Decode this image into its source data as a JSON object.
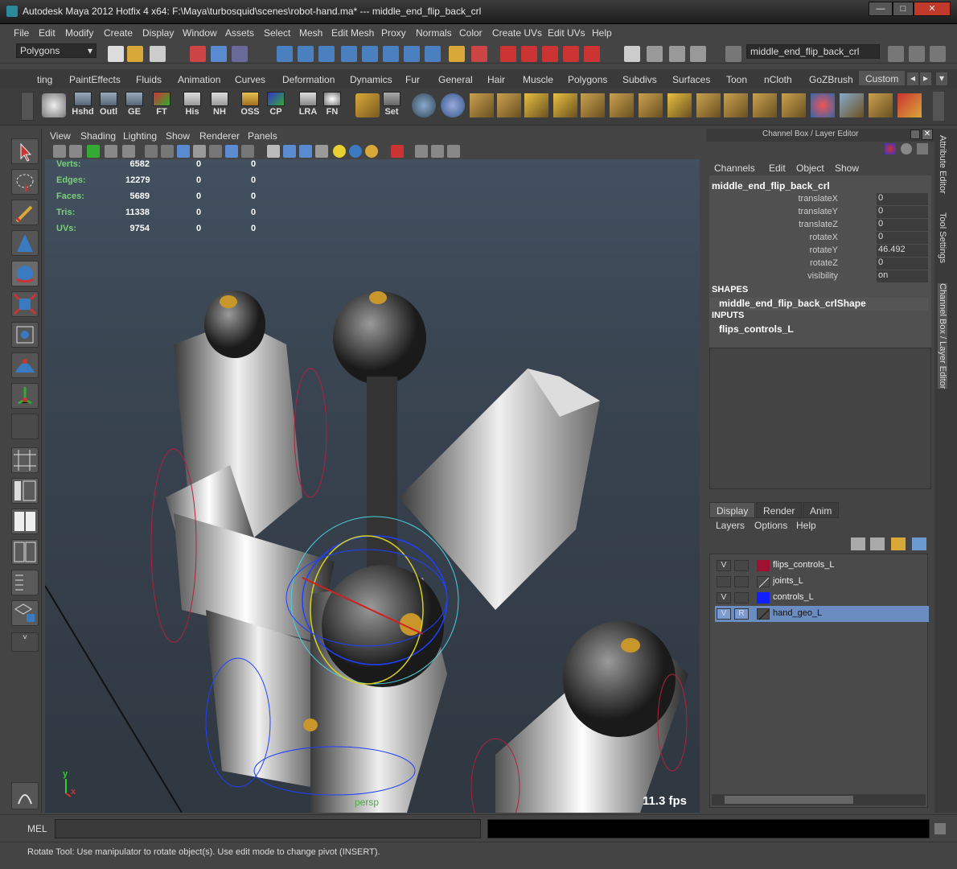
{
  "window": {
    "title": "Autodesk Maya 2012 Hotfix 4 x64: F:\\Maya\\turbosquid\\scenes\\robot-hand.ma*   ---   middle_end_flip_back_crl",
    "min": "—",
    "max": "□",
    "close": "✕"
  },
  "menubar": [
    "File",
    "Edit",
    "Modify",
    "Create",
    "Display",
    "Window",
    "Assets",
    "Select",
    "Mesh",
    "Edit Mesh",
    "Proxy",
    "Normals",
    "Color",
    "Create UVs",
    "Edit UVs",
    "Help"
  ],
  "statusline": {
    "mode": "Polygons",
    "selection_field": "middle_end_flip_back_crl"
  },
  "shelf_tabs": [
    "ting",
    "PaintEffects",
    "Fluids",
    "Animation",
    "Curves",
    "Deformation",
    "Dynamics",
    "Fur",
    "General",
    "Hair",
    "Muscle",
    "Polygons",
    "Subdivs",
    "Surfaces",
    "Toon",
    "nCloth",
    "GoZBrush",
    "Custom"
  ],
  "shelf_active_tab": "Custom",
  "shelf_buttons": [
    "Hshd",
    "Outl",
    "GE",
    "FT",
    "His",
    "NH",
    "OSS",
    "CP",
    "LRA",
    "FN",
    "Set"
  ],
  "viewport": {
    "menu": [
      "View",
      "Shading",
      "Lighting",
      "Show",
      "Renderer",
      "Panels"
    ],
    "stats": [
      {
        "label": "Verts:",
        "a": "6582",
        "b": "0",
        "c": "0"
      },
      {
        "label": "Edges:",
        "a": "12279",
        "b": "0",
        "c": "0"
      },
      {
        "label": "Faces:",
        "a": "5689",
        "b": "0",
        "c": "0"
      },
      {
        "label": "Tris:",
        "a": "11338",
        "b": "0",
        "c": "0"
      },
      {
        "label": "UVs:",
        "a": "9754",
        "b": "0",
        "c": "0"
      }
    ],
    "fps": "11.3 fps",
    "camera": "persp",
    "axis_y": "y",
    "axis_x": "x"
  },
  "channel_box": {
    "header": "Channel Box / Layer Editor",
    "menu": [
      "Channels",
      "Edit",
      "Object",
      "Show"
    ],
    "node": "middle_end_flip_back_crl",
    "attributes": [
      {
        "name": "translateX",
        "value": "0"
      },
      {
        "name": "translateY",
        "value": "0"
      },
      {
        "name": "translateZ",
        "value": "0"
      },
      {
        "name": "rotateX",
        "value": "0"
      },
      {
        "name": "rotateY",
        "value": "46.492"
      },
      {
        "name": "rotateZ",
        "value": "0"
      },
      {
        "name": "visibility",
        "value": "on"
      }
    ],
    "shapes_label": "SHAPES",
    "shape_node": "middle_end_flip_back_crlShape",
    "inputs_label": "INPUTS",
    "input_node": "flips_controls_L"
  },
  "layer_editor": {
    "tabs": [
      "Display",
      "Render",
      "Anim"
    ],
    "menu": [
      "Layers",
      "Options",
      "Help"
    ],
    "layers": [
      {
        "name": "flips_controls_L",
        "v": "V",
        "r": "",
        "color": "#a01030",
        "selected": false
      },
      {
        "name": "joints_L",
        "v": "",
        "r": "",
        "color": "",
        "selected": false
      },
      {
        "name": "controls_L",
        "v": "V",
        "r": "",
        "color": "#1020ff",
        "selected": false
      },
      {
        "name": "hand_geo_L",
        "v": "V",
        "r": "R",
        "color": "",
        "selected": true
      }
    ]
  },
  "side_tabs": [
    "Attribute Editor",
    "Tool Settings",
    "Channel Box / Layer Editor"
  ],
  "command_line": {
    "label": "MEL",
    "value": ""
  },
  "help_line": "Rotate Tool: Use manipulator to rotate object(s). Use edit mode to change pivot (INSERT)."
}
